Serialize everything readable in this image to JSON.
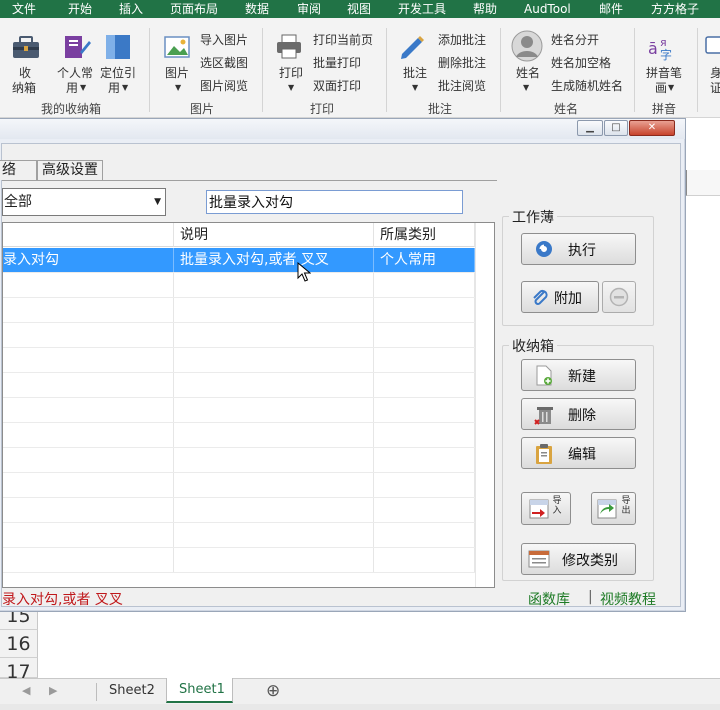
{
  "ribbon_tabs": [
    "文件",
    "开始",
    "插入",
    "页面布局",
    "数据",
    "审阅",
    "视图",
    "开发工具",
    "帮助",
    "AudTool",
    "邮件",
    "方方格子"
  ],
  "ribbon": {
    "box_btn_line1": "收",
    "box_btn_line2": "纳箱",
    "personal_line1": "个人常",
    "personal_line2": "用",
    "locate_line1": "定位引",
    "locate_line2": "用",
    "group_box": "我的收纳箱",
    "pictures_btn": "图片",
    "import_pic": "导入图片",
    "screenshot": "选区截图",
    "pic_browse": "图片阅览",
    "group_pictures": "图片",
    "print_btn": "打印",
    "print_current": "打印当前页",
    "batch_print": "批量打印",
    "duplex_print": "双面打印",
    "group_print": "打印",
    "comment_btn": "批注",
    "add_comment": "添加批注",
    "delete_comment": "删除批注",
    "comment_browse": "批注阅览",
    "group_comment": "批注",
    "name_btn": "姓名",
    "split_name": "姓名分开",
    "name_space": "姓名加空格",
    "random_name": "生成随机姓名",
    "group_name": "姓名",
    "pinyin_line1": "拼音笔",
    "pinyin_line2": "画",
    "group_pinyin": "拼音",
    "cut_label_line1": "身",
    "cut_label_line2": "证"
  },
  "dialog": {
    "minimize": "▁",
    "restore": "□",
    "close": "✕",
    "tabs": [
      "络",
      "高级设置"
    ],
    "category_select": "全部",
    "search_value": "批量录入对勾",
    "table": {
      "headers": [
        "",
        "说明",
        "所属类别"
      ],
      "rows": [
        {
          "name": "录入对勾",
          "desc": "批量录入对勾,或者 叉叉",
          "category": "个人常用"
        }
      ]
    },
    "workbook_group": "工作薄",
    "execute_button": "执行",
    "attach_button": "附加",
    "storage_group": "收纳箱",
    "new_button": "新建",
    "delete_button": "删除",
    "edit_button": "编辑",
    "import_tag": "导入",
    "export_tag": "导出",
    "modify_category_button": "修改类别",
    "status_message": "录入对勾,或者 叉叉",
    "function_library_link": "函数库",
    "link_separator": "|",
    "video_tutorial_link": "视频教程"
  },
  "sheet": {
    "row_numbers": [
      "15",
      "16",
      "17"
    ],
    "tabs": [
      "Sheet2",
      "Sheet1"
    ],
    "active_tab": "Sheet1",
    "add_sheet": "⊕",
    "prev_arrow": "◀",
    "next_arrow": "▶"
  },
  "colors": {
    "ribbon_green": "#217346",
    "selection_blue": "#3399ff",
    "status_red": "#c0181b",
    "link_green": "#1e7b26"
  }
}
